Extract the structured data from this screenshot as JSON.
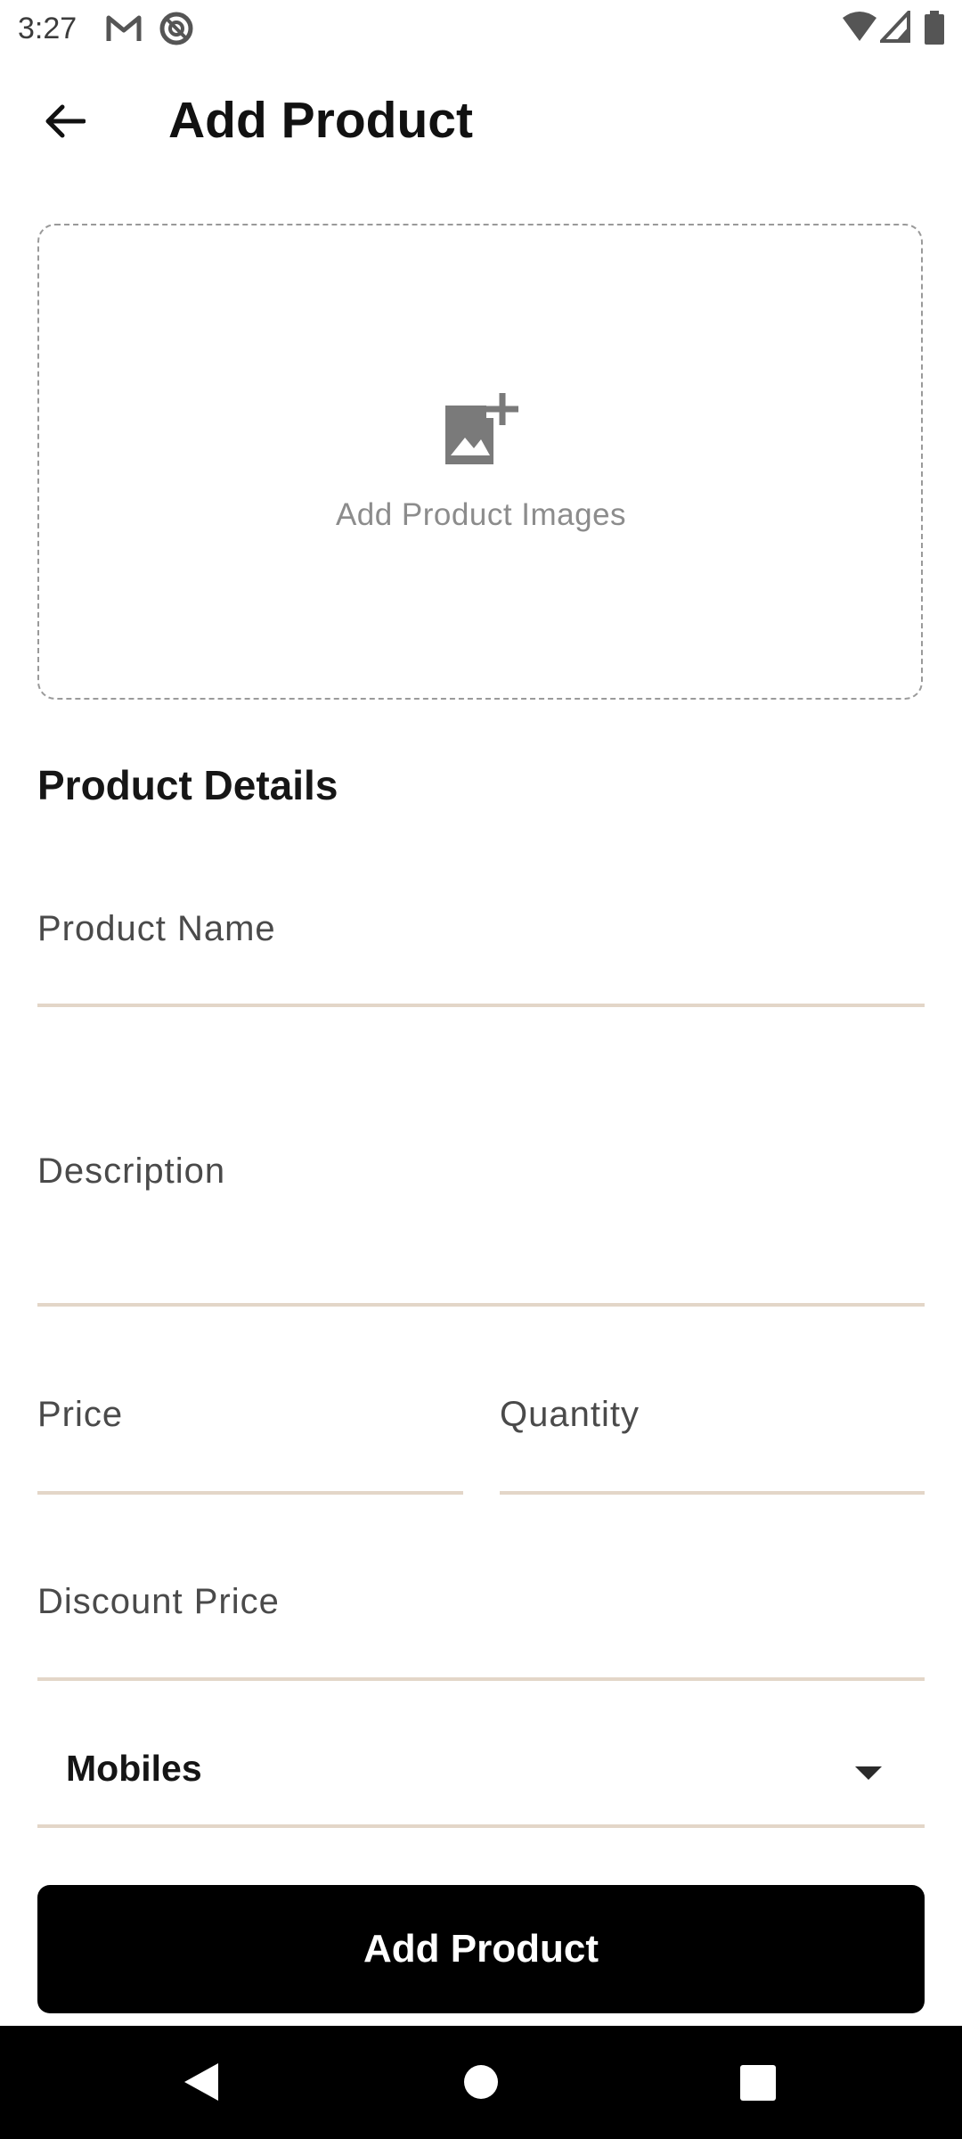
{
  "status_bar": {
    "time": "3:27",
    "left_icons": [
      "gmail-icon",
      "at-sign-icon"
    ],
    "right_icons": [
      "wifi-icon",
      "signal-icon",
      "battery-icon"
    ]
  },
  "app_bar": {
    "title": "Add Product",
    "back_icon": "arrow-back-icon"
  },
  "image_picker": {
    "icon": "add-photo-icon",
    "label": "Add Product Images"
  },
  "section_title": "Product Details",
  "fields": {
    "product_name": {
      "label": "Product Name",
      "value": ""
    },
    "description": {
      "label": "Description",
      "value": ""
    },
    "price": {
      "label": "Price",
      "value": ""
    },
    "quantity": {
      "label": "Quantity",
      "value": ""
    },
    "discount_price": {
      "label": "Discount Price",
      "value": ""
    }
  },
  "category_dropdown": {
    "selected": "Mobiles",
    "icon": "dropdown-arrow-icon"
  },
  "submit_button": {
    "label": "Add Product"
  },
  "colors": {
    "accent_underline": "#e3d6c8",
    "button_bg": "#000000",
    "button_text": "#ffffff"
  },
  "nav_bar": {
    "icons": [
      "nav-back-icon",
      "nav-home-icon",
      "nav-recents-icon"
    ]
  }
}
